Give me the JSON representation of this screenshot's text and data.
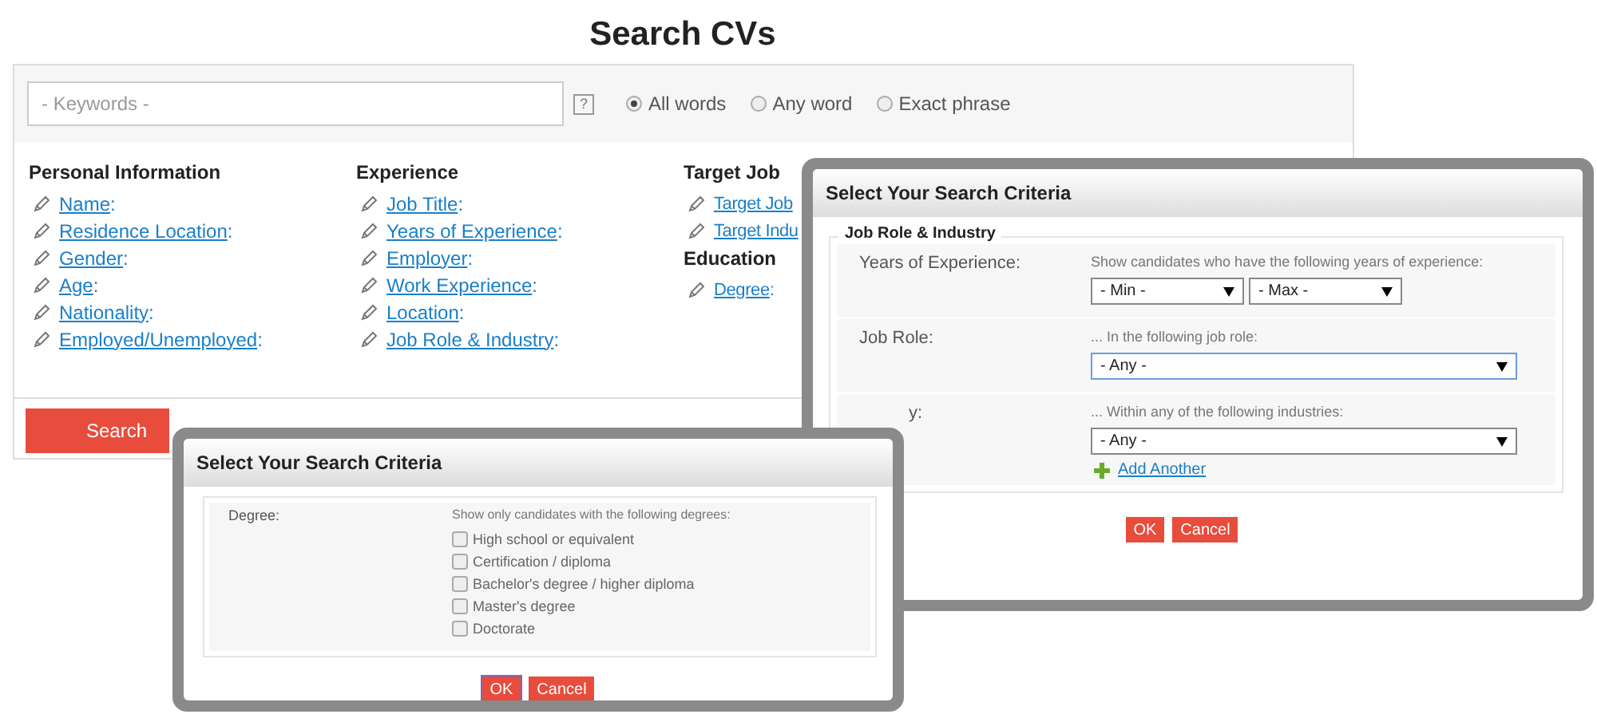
{
  "page_title": "Search CVs",
  "search": {
    "placeholder": "- Keywords -",
    "help": "?",
    "match_options": [
      {
        "label": "All words",
        "selected": true
      },
      {
        "label": "Any word",
        "selected": false
      },
      {
        "label": "Exact phrase",
        "selected": false
      }
    ]
  },
  "criteria_columns": [
    {
      "sections": [
        {
          "heading": "Personal Information",
          "fields": [
            {
              "label": "Name",
              "suffix": ":"
            },
            {
              "label": "Residence Location",
              "suffix": ":"
            },
            {
              "label": "Gender",
              "suffix": ":"
            },
            {
              "label": "Age",
              "suffix": ":"
            },
            {
              "label": "Nationality",
              "suffix": ":"
            },
            {
              "label": "Employed/Unemployed",
              "suffix": ":"
            }
          ]
        }
      ]
    },
    {
      "sections": [
        {
          "heading": "Experience",
          "fields": [
            {
              "label": "Job Title",
              "suffix": ":"
            },
            {
              "label": "Years of Experience",
              "suffix": ":"
            },
            {
              "label": "Employer",
              "suffix": ":"
            },
            {
              "label": "Work Experience",
              "suffix": ":"
            },
            {
              "label": "Location",
              "suffix": ":"
            },
            {
              "label": "Job Role & Industry",
              "suffix": ":"
            }
          ]
        }
      ]
    },
    {
      "sections": [
        {
          "heading": "Target Job",
          "fields": [
            {
              "label": "Target Job"
            },
            {
              "label": "Target Indu"
            }
          ]
        },
        {
          "heading": "Education",
          "fields": [
            {
              "label": "Degree",
              "suffix": ":"
            }
          ]
        }
      ]
    }
  ],
  "search_button": "Search",
  "role_dialog": {
    "title": "Select Your Search Criteria",
    "legend": "Job Role & Industry",
    "rows": [
      {
        "kind": "range",
        "label": "Years of Experience:",
        "hint": "Show candidates who have the following years of experience:",
        "selects": [
          "- Min -",
          "- Max -"
        ],
        "focused": false
      },
      {
        "kind": "select",
        "label": "Job Role:",
        "hint": "... In the following job role:",
        "selects": [
          "- Any -"
        ],
        "focused": true
      },
      {
        "kind": "select",
        "label": "y:",
        "hint": "... Within any of the following industries:",
        "selects": [
          "- Any -"
        ],
        "focused": false,
        "add_link": "Add Another"
      }
    ],
    "buttons": [
      {
        "label": "OK",
        "focused": false
      },
      {
        "label": "Cancel",
        "focused": false
      }
    ]
  },
  "degree_dialog": {
    "title": "Select Your Search Criteria",
    "label": "Degree:",
    "hint": "Show only candidates with the following degrees:",
    "options": [
      {
        "label": "High school or equivalent",
        "checked": false
      },
      {
        "label": "Certification / diploma",
        "checked": false
      },
      {
        "label": "Bachelor's degree / higher diploma",
        "checked": false
      },
      {
        "label": "Master's degree",
        "checked": false
      },
      {
        "label": "Doctorate",
        "checked": false
      }
    ],
    "buttons": [
      {
        "label": "OK",
        "focused": true
      },
      {
        "label": "Cancel",
        "focused": false
      }
    ]
  }
}
